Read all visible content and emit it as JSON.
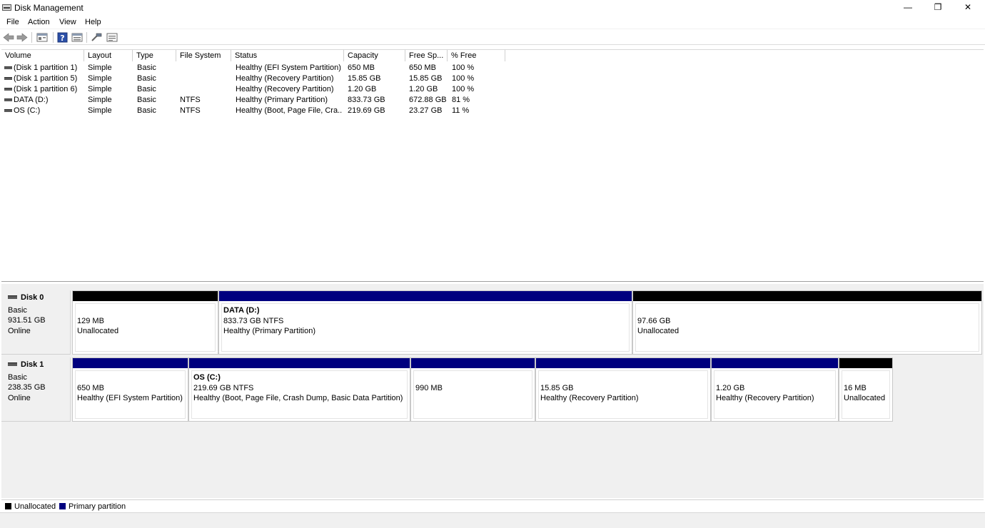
{
  "window": {
    "title": "Disk Management",
    "minimize": "—",
    "restore": "❐",
    "close": "✕"
  },
  "menu": [
    "File",
    "Action",
    "View",
    "Help"
  ],
  "toolbar": {
    "icons": [
      "back-arrow-icon",
      "forward-arrow-icon",
      "properties-icon",
      "help-icon",
      "show-hide-console-icon",
      "connect-icon",
      "details-icon"
    ]
  },
  "columns": [
    "Volume",
    "Layout",
    "Type",
    "File System",
    "Status",
    "Capacity",
    "Free Sp...",
    "% Free"
  ],
  "volumes": [
    {
      "volume": "(Disk 1 partition 1)",
      "layout": "Simple",
      "type": "Basic",
      "fs": "",
      "status": "Healthy (EFI System Partition)",
      "capacity": "650 MB",
      "free": "650 MB",
      "pct": "100 %"
    },
    {
      "volume": "(Disk 1 partition 5)",
      "layout": "Simple",
      "type": "Basic",
      "fs": "",
      "status": "Healthy (Recovery Partition)",
      "capacity": "15.85 GB",
      "free": "15.85 GB",
      "pct": "100 %"
    },
    {
      "volume": "(Disk 1 partition 6)",
      "layout": "Simple",
      "type": "Basic",
      "fs": "",
      "status": "Healthy (Recovery Partition)",
      "capacity": "1.20 GB",
      "free": "1.20 GB",
      "pct": "100 %"
    },
    {
      "volume": "DATA (D:)",
      "layout": "Simple",
      "type": "Basic",
      "fs": "NTFS",
      "status": "Healthy (Primary Partition)",
      "capacity": "833.73 GB",
      "free": "672.88 GB",
      "pct": "81 %"
    },
    {
      "volume": "OS (C:)",
      "layout": "Simple",
      "type": "Basic",
      "fs": "NTFS",
      "status": "Healthy (Boot, Page File, Cra...",
      "capacity": "219.69 GB",
      "free": "23.27 GB",
      "pct": "11 %"
    }
  ],
  "disks": [
    {
      "name": "Disk 0",
      "type": "Basic",
      "size": "931.51 GB",
      "state": "Online",
      "partitions": [
        {
          "kind": "unallocated",
          "name": "",
          "line1": "129 MB",
          "line2": "Unallocated"
        },
        {
          "kind": "primary",
          "name": "DATA  (D:)",
          "line1": "833.73 GB NTFS",
          "line2": "Healthy (Primary Partition)"
        },
        {
          "kind": "unallocated",
          "name": "",
          "line1": "97.66 GB",
          "line2": "Unallocated"
        }
      ]
    },
    {
      "name": "Disk 1",
      "type": "Basic",
      "size": "238.35 GB",
      "state": "Online",
      "partitions": [
        {
          "kind": "primary",
          "name": "",
          "line1": "650 MB",
          "line2": "Healthy (EFI System Partition)"
        },
        {
          "kind": "primary",
          "name": "OS  (C:)",
          "line1": "219.69 GB NTFS",
          "line2": "Healthy (Boot, Page File, Crash Dump, Basic Data Partition)"
        },
        {
          "kind": "primary",
          "name": "",
          "line1": "990 MB",
          "line2": ""
        },
        {
          "kind": "primary",
          "name": "",
          "line1": "15.85 GB",
          "line2": "Healthy (Recovery Partition)"
        },
        {
          "kind": "primary",
          "name": "",
          "line1": "1.20 GB",
          "line2": "Healthy (Recovery Partition)"
        },
        {
          "kind": "unallocated",
          "name": "",
          "line1": "16 MB",
          "line2": "Unallocated"
        }
      ]
    }
  ],
  "legend": [
    {
      "label": "Unallocated",
      "color": "#000000"
    },
    {
      "label": "Primary partition",
      "color": "#00007f"
    }
  ],
  "colors": {
    "primary": "#00007f",
    "unallocated": "#000000"
  }
}
